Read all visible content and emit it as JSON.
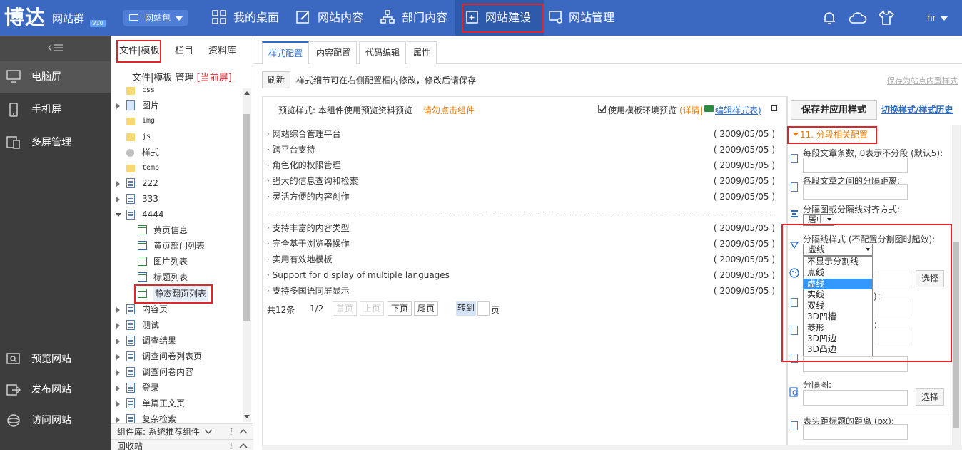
{
  "brand": {
    "logo": "博达",
    "name": "网站群",
    "version": "V10"
  },
  "site_selector": "网站包",
  "nav": [
    "我的桌面",
    "网站内容",
    "部门内容",
    "网站建设",
    "网站管理"
  ],
  "user": "hr",
  "sidebar": {
    "top": [
      "电脑屏",
      "手机屏",
      "多屏管理"
    ],
    "bottom": [
      "预览网站",
      "发布网站",
      "访问网站"
    ]
  },
  "tree": {
    "tabs": [
      "文件|模板",
      "栏目",
      "资料库"
    ],
    "subtitle": "文件|模板 管理",
    "subtitle_flag": "[当前屏]",
    "items": [
      "css",
      "图片",
      "img",
      "js",
      "样式",
      "temp",
      "222",
      "333",
      "4444",
      "黄页信息",
      "黄页部门列表",
      "图片列表",
      "标题列表",
      "静态翻页列表",
      "内容页",
      "测试",
      "调查结果",
      "调查问卷列表页",
      "调查问卷内容",
      "登录",
      "单篇正文页",
      "复杂检索"
    ],
    "component_lib": "组件库: 系统推荐组件",
    "recycle": "回收站"
  },
  "main": {
    "tabs": [
      "样式配置",
      "内容配置",
      "代码编辑",
      "属性"
    ],
    "refresh": "刷新",
    "tip": "样式细节可在右侧配置框内修改，修改后请保存",
    "save_site": "保存为站点内置样式",
    "preview_label": "预览样式: 本组件使用预览资料预览",
    "preview_warn": "请勿点击组件",
    "use_env": "使用模板环境预览",
    "detail": "(详情|",
    "edit_style": "编辑样式表)"
  },
  "list1": [
    {
      "title": "· 网站综合管理平台",
      "date": "( 2009/05/05 )"
    },
    {
      "title": "· 跨平台支持",
      "date": "( 2009/05/05 )"
    },
    {
      "title": "· 角色化的权限管理",
      "date": "( 2009/05/05 )"
    },
    {
      "title": "· 强大的信息查询和检索",
      "date": "( 2009/05/05 )"
    },
    {
      "title": "· 灵活方便的内容创作",
      "date": "( 2009/05/05 )"
    }
  ],
  "list2": [
    {
      "title": "· 支持丰富的内容类型",
      "date": "( 2009/05/05 )"
    },
    {
      "title": "· 完全基于浏览器操作",
      "date": "( 2009/05/05 )"
    },
    {
      "title": "· 实用有效地模板",
      "date": "( 2009/05/05 )"
    },
    {
      "title": "· Support for display of multiple languages",
      "date": "( 2009/05/05 )"
    },
    {
      "title": "· 支持多国语同屏显示",
      "date": "( 2009/05/05 )"
    }
  ],
  "pager": {
    "total": "共12条",
    "page": "1/2",
    "first": "首页",
    "prev": "上页",
    "next": "下页",
    "last": "尾页",
    "goto": "转到",
    "unit": "页"
  },
  "cfg": {
    "save": "保存并应用样式",
    "switch": "切换样式/样式历史",
    "section": "11. 分段相关配置",
    "f1": "每段文章条数, 0表示不分段 (默认5):",
    "f2": "各段文章之间的分隔距离:",
    "f3": "分隔图或分隔线对齐方式:",
    "f3_value": "居中",
    "f4": "分隔线样式 (不配置分割图时起效):",
    "f4_value": "虚线",
    "dd_options": [
      "不显示分割线",
      "点线",
      "虚线",
      "实线",
      "双线",
      "3D凹槽",
      "菱形",
      "3D凹边",
      "3D凸边"
    ],
    "select": "选择",
    "partial_1": ")：",
    "partial_2": "：",
    "f_img": "分隔图:",
    "f_last": "表头距标题的距离 (px):"
  }
}
